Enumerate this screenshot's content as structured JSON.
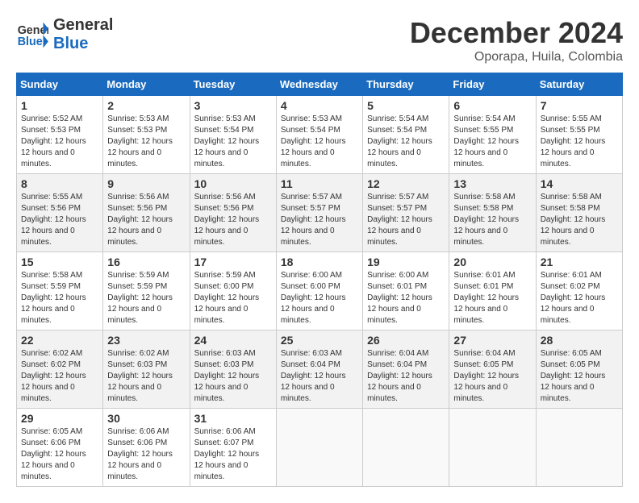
{
  "logo": {
    "line1": "General",
    "line2": "Blue"
  },
  "title": "December 2024",
  "location": "Oporapa, Huila, Colombia",
  "headers": [
    "Sunday",
    "Monday",
    "Tuesday",
    "Wednesday",
    "Thursday",
    "Friday",
    "Saturday"
  ],
  "weeks": [
    [
      {
        "day": "1",
        "sunrise": "5:52 AM",
        "sunset": "5:53 PM",
        "daylight": "12 hours and 0 minutes."
      },
      {
        "day": "2",
        "sunrise": "5:53 AM",
        "sunset": "5:53 PM",
        "daylight": "12 hours and 0 minutes."
      },
      {
        "day": "3",
        "sunrise": "5:53 AM",
        "sunset": "5:54 PM",
        "daylight": "12 hours and 0 minutes."
      },
      {
        "day": "4",
        "sunrise": "5:53 AM",
        "sunset": "5:54 PM",
        "daylight": "12 hours and 0 minutes."
      },
      {
        "day": "5",
        "sunrise": "5:54 AM",
        "sunset": "5:54 PM",
        "daylight": "12 hours and 0 minutes."
      },
      {
        "day": "6",
        "sunrise": "5:54 AM",
        "sunset": "5:55 PM",
        "daylight": "12 hours and 0 minutes."
      },
      {
        "day": "7",
        "sunrise": "5:55 AM",
        "sunset": "5:55 PM",
        "daylight": "12 hours and 0 minutes."
      }
    ],
    [
      {
        "day": "8",
        "sunrise": "5:55 AM",
        "sunset": "5:56 PM",
        "daylight": "12 hours and 0 minutes."
      },
      {
        "day": "9",
        "sunrise": "5:56 AM",
        "sunset": "5:56 PM",
        "daylight": "12 hours and 0 minutes."
      },
      {
        "day": "10",
        "sunrise": "5:56 AM",
        "sunset": "5:56 PM",
        "daylight": "12 hours and 0 minutes."
      },
      {
        "day": "11",
        "sunrise": "5:57 AM",
        "sunset": "5:57 PM",
        "daylight": "12 hours and 0 minutes."
      },
      {
        "day": "12",
        "sunrise": "5:57 AM",
        "sunset": "5:57 PM",
        "daylight": "12 hours and 0 minutes."
      },
      {
        "day": "13",
        "sunrise": "5:58 AM",
        "sunset": "5:58 PM",
        "daylight": "12 hours and 0 minutes."
      },
      {
        "day": "14",
        "sunrise": "5:58 AM",
        "sunset": "5:58 PM",
        "daylight": "12 hours and 0 minutes."
      }
    ],
    [
      {
        "day": "15",
        "sunrise": "5:58 AM",
        "sunset": "5:59 PM",
        "daylight": "12 hours and 0 minutes."
      },
      {
        "day": "16",
        "sunrise": "5:59 AM",
        "sunset": "5:59 PM",
        "daylight": "12 hours and 0 minutes."
      },
      {
        "day": "17",
        "sunrise": "5:59 AM",
        "sunset": "6:00 PM",
        "daylight": "12 hours and 0 minutes."
      },
      {
        "day": "18",
        "sunrise": "6:00 AM",
        "sunset": "6:00 PM",
        "daylight": "12 hours and 0 minutes."
      },
      {
        "day": "19",
        "sunrise": "6:00 AM",
        "sunset": "6:01 PM",
        "daylight": "12 hours and 0 minutes."
      },
      {
        "day": "20",
        "sunrise": "6:01 AM",
        "sunset": "6:01 PM",
        "daylight": "12 hours and 0 minutes."
      },
      {
        "day": "21",
        "sunrise": "6:01 AM",
        "sunset": "6:02 PM",
        "daylight": "12 hours and 0 minutes."
      }
    ],
    [
      {
        "day": "22",
        "sunrise": "6:02 AM",
        "sunset": "6:02 PM",
        "daylight": "12 hours and 0 minutes."
      },
      {
        "day": "23",
        "sunrise": "6:02 AM",
        "sunset": "6:03 PM",
        "daylight": "12 hours and 0 minutes."
      },
      {
        "day": "24",
        "sunrise": "6:03 AM",
        "sunset": "6:03 PM",
        "daylight": "12 hours and 0 minutes."
      },
      {
        "day": "25",
        "sunrise": "6:03 AM",
        "sunset": "6:04 PM",
        "daylight": "12 hours and 0 minutes."
      },
      {
        "day": "26",
        "sunrise": "6:04 AM",
        "sunset": "6:04 PM",
        "daylight": "12 hours and 0 minutes."
      },
      {
        "day": "27",
        "sunrise": "6:04 AM",
        "sunset": "6:05 PM",
        "daylight": "12 hours and 0 minutes."
      },
      {
        "day": "28",
        "sunrise": "6:05 AM",
        "sunset": "6:05 PM",
        "daylight": "12 hours and 0 minutes."
      }
    ],
    [
      {
        "day": "29",
        "sunrise": "6:05 AM",
        "sunset": "6:06 PM",
        "daylight": "12 hours and 0 minutes."
      },
      {
        "day": "30",
        "sunrise": "6:06 AM",
        "sunset": "6:06 PM",
        "daylight": "12 hours and 0 minutes."
      },
      {
        "day": "31",
        "sunrise": "6:06 AM",
        "sunset": "6:07 PM",
        "daylight": "12 hours and 0 minutes."
      },
      null,
      null,
      null,
      null
    ]
  ],
  "labels": {
    "sunrise": "Sunrise:",
    "sunset": "Sunset:",
    "daylight": "Daylight: 12 hours"
  }
}
